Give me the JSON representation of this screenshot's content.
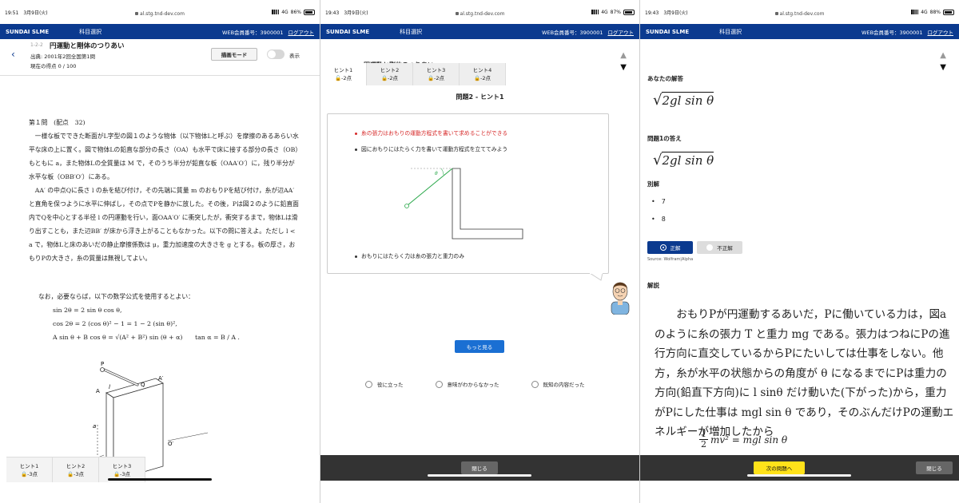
{
  "panel1": {
    "status": {
      "time": "19:51",
      "date": "3月9日(火)",
      "url": "al.stg.tnd-dev.com",
      "network": "4G",
      "battery": "86%"
    },
    "appbar": {
      "brand": "SUNDAI SLME",
      "subject_select": "科目選択",
      "member_no": "WEB会員番号：3900001",
      "logout": "ログアウト"
    },
    "header": {
      "crumb": "1-2-2",
      "title": "円運動と剛体のつりあい",
      "source": "出典: 2001年2回全国第1問",
      "points": "現在の得点 0 / 100",
      "mode_button": "描画モード",
      "toggle_label": "表示"
    },
    "question": {
      "heading": "第１問　(配点　32)",
      "para1": "一様な板でできた断面がL字型の図１のような物体（以下物体Lと呼ぶ）を摩擦のあるあらい水平な床の上に置く。図で物体Lの鉛直な部分の長さ（OA）も水平で床に接する部分の長さ（OB）もともに a，また物体Lの全質量は M で，そのうち半分が鉛直な板（OAA′O′）に，残り半分が水平な板（OBB′O′）にある。",
      "para2": "AA′ の中点Qに長さ l の糸を結び付け，その先端に質量 m のおもりPを結び付け，糸が辺AA′ と直角を保つように水平に伸ばし，その点でPを静かに放した。その後，Pは図２のように鉛直面内でQを中心とする半径 l の円運動を行い，面OAA′O′ に衝突したが，衝突するまで，物体Lは滑り出すことも，また辺BB′ が床から浮き上がることもなかった。以下の問に答えよ。ただし l < a で，物体Lと床のあいだの静止摩擦係数は μ，重力加速度の大きさを g とする。板の厚さ，おもりPの大きさ，糸の質量は無視してよい。",
      "formula_intro": "なお，必要ならば，以下の数学公式を使用するとよい：",
      "formula1": "sin 2θ = 2 sin θ cos θ,",
      "formula2": "cos 2θ = 2 (cos θ)² − 1 = 1 − 2 (sin θ)²,",
      "formula3": "A sin θ + B cos θ = √(A² + B²) sin (θ + α)　　tan α = B / A ."
    },
    "figure_labels": {
      "p": "P",
      "q": "Q",
      "l": "l",
      "a_top": "A",
      "a_prime": "A′",
      "a_side": "a",
      "floor": "床",
      "o_prime": "O′"
    },
    "hints": [
      {
        "label": "ヒント1",
        "cost": "-3点"
      },
      {
        "label": "ヒント2",
        "cost": "-3点"
      },
      {
        "label": "ヒント3",
        "cost": "-3点"
      }
    ]
  },
  "panel2": {
    "status": {
      "time": "19:43",
      "date": "3月9日(火)",
      "url": "al.stg.tnd-dev.com",
      "network": "4G",
      "battery": "87%"
    },
    "appbar": {
      "brand": "SUNDAI SLME",
      "subject_select": "科目選択",
      "member_no": "WEB会員番号：3900001",
      "logout": "ログアウト"
    },
    "sub_title": "円運動と剛体のつりあい",
    "hints": [
      {
        "label": "ヒント1",
        "cost": "-2点"
      },
      {
        "label": "ヒント2",
        "cost": "-2点"
      },
      {
        "label": "ヒント3",
        "cost": "-2点"
      },
      {
        "label": "ヒント4",
        "cost": "-2点"
      }
    ],
    "question_title": "問題2 - ヒント1",
    "bullet1": "糸の張力はおもりの運動方程式を書いて求めることができる",
    "bullet2": "図におもりにはたらく力を書いて運動方程式を立ててみよう",
    "bullet3": "おもりにはたらく力は糸の張力と重力のみ",
    "theta": "θ",
    "more_button": "もっと見る",
    "feedback": [
      "役に立った",
      "意味がわからなかった",
      "既知の内容だった"
    ],
    "close_button": "閉じる",
    "colors": {
      "accent": "#1a6fd3",
      "highlight": "#d62828",
      "string": "#2aa84a"
    }
  },
  "panel3": {
    "status": {
      "time": "19:43",
      "date": "3月9日(火)",
      "url": "al.stg.tnd-dev.com",
      "network": "4G",
      "battery": "88%"
    },
    "appbar": {
      "brand": "SUNDAI SLME",
      "subject_select": "科目選択",
      "member_no": "WEB会員番号：3900001",
      "logout": "ログアウト"
    },
    "your_answer_label": "あなたの解答",
    "your_answer": "2gl sin θ",
    "correct_answer_label": "問題1の答え",
    "correct_answer": "2gl sin θ",
    "alt_label": "別解",
    "alt_items": [
      "7",
      "8"
    ],
    "correct_button": "正解",
    "wrong_button": "不正解",
    "source_note": "Source: Wolfram|Alpha",
    "explanation_label": "解説",
    "explanation": "おもりPが円運動するあいだ，Pに働いている力は，図aのように糸の張力 T と重力 mg である。張力はつねにPの進行方向に直交しているからPにたいしては仕事をしない。他方，糸が水平の状態からの角度が θ になるまでにPは重力の方向(鉛直下方向)に l sinθ だけ動いた(下がった)から，重力がPにした仕事は mgl sin θ であり，そのぶんだけPの運動エネルギーが増加したから",
    "equation_num": "1",
    "equation_den": "2",
    "equation_rest": "mv² = mgl sin θ",
    "next_button": "次の問題へ",
    "close_button": "閉じる",
    "colors": {
      "brand": "#0b3a8f",
      "next": "#ffe21a"
    }
  }
}
